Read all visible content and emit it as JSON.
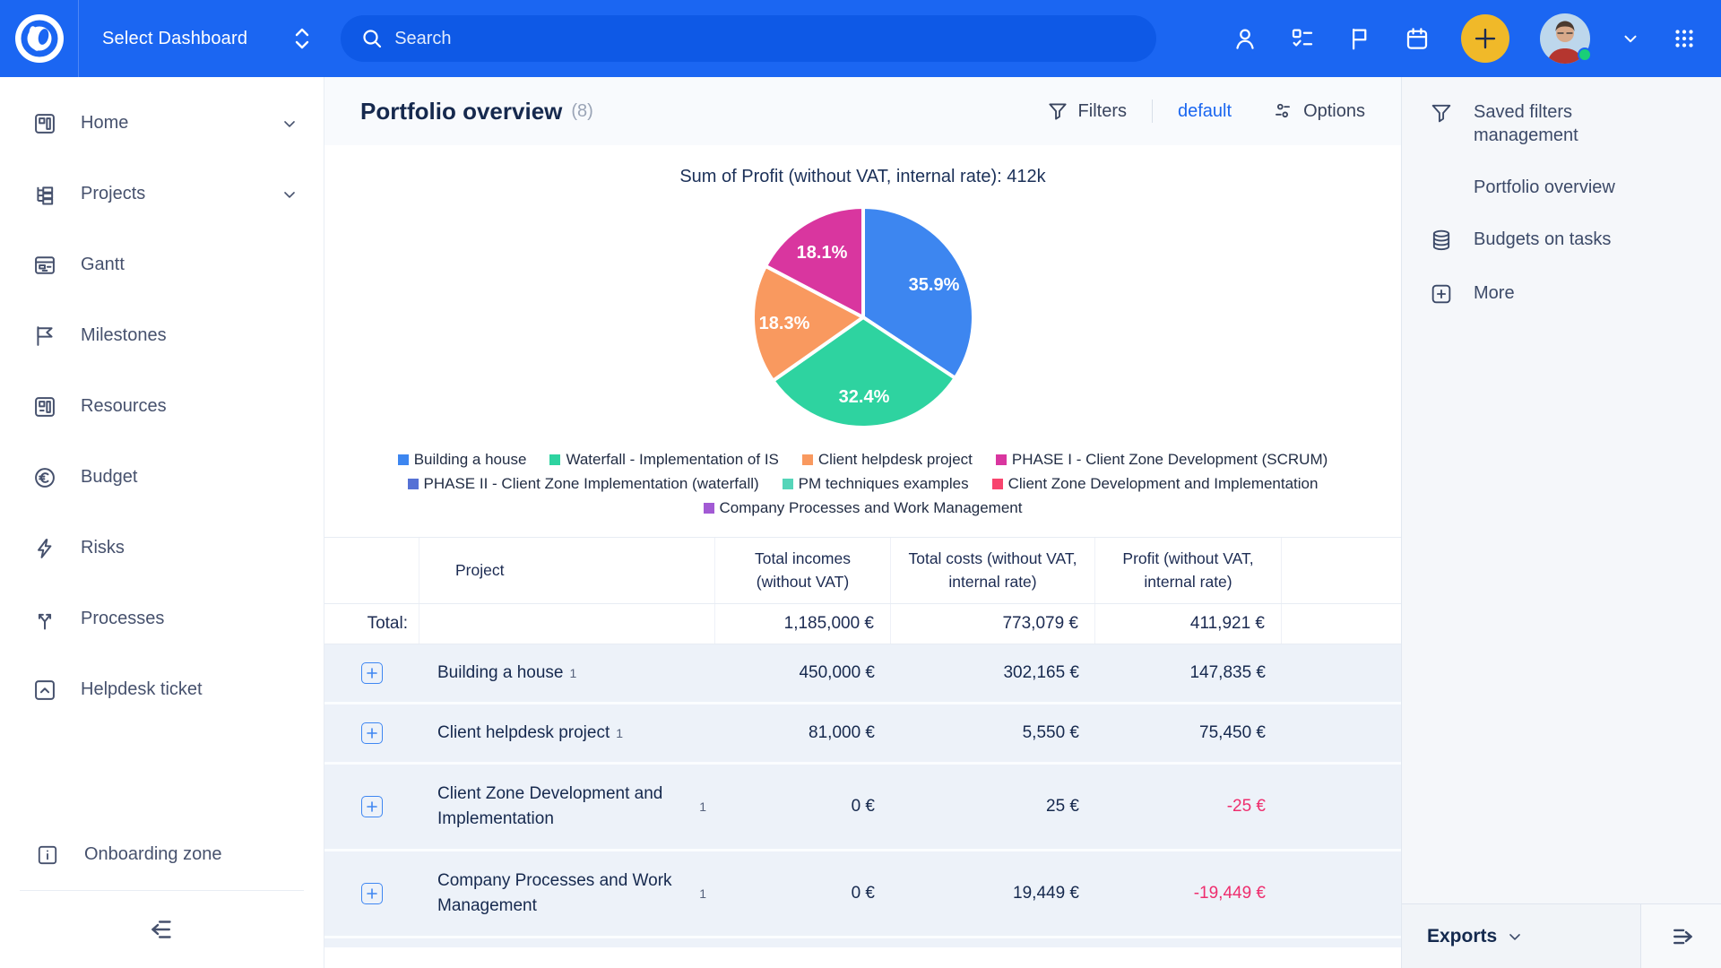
{
  "topbar": {
    "dashboard_selector": "Select Dashboard",
    "search_placeholder": "Search",
    "icons": [
      "user",
      "tasks-checklist",
      "flag",
      "calendar",
      "add",
      "avatar",
      "caret-down",
      "apps-grid"
    ],
    "colors": {
      "bar": "#1b66f2",
      "add_button": "#f0b929",
      "online_dot": "#19cf78"
    }
  },
  "sidebar": {
    "items": [
      {
        "label": "Home",
        "icon": "dashboard-icon",
        "expandable": true
      },
      {
        "label": "Projects",
        "icon": "projects-tree-icon",
        "expandable": true
      },
      {
        "label": "Gantt",
        "icon": "gantt-icon",
        "expandable": false
      },
      {
        "label": "Milestones",
        "icon": "flag-icon",
        "expandable": false
      },
      {
        "label": "Resources",
        "icon": "resources-icon",
        "expandable": false
      },
      {
        "label": "Budget",
        "icon": "euro-circle-icon",
        "expandable": false
      },
      {
        "label": "Risks",
        "icon": "lightning-icon",
        "expandable": false
      },
      {
        "label": "Processes",
        "icon": "fork-icon",
        "expandable": false
      },
      {
        "label": "Helpdesk ticket",
        "icon": "helpdesk-icon",
        "expandable": false
      }
    ],
    "footer_item": {
      "label": "Onboarding zone",
      "icon": "info-icon"
    }
  },
  "main": {
    "title": "Portfolio overview",
    "count": "(8)",
    "filters_label": "Filters",
    "filters_value": "default",
    "options_label": "Options"
  },
  "chart_data": {
    "type": "pie",
    "title": "Sum of Profit (without VAT, internal rate): 412k",
    "legend_position": "bottom",
    "slices": [
      {
        "label": "Building a house",
        "value_pct": 35.9,
        "display": "35.9%",
        "color": "#3d86f0"
      },
      {
        "label": "Waterfall - Implementation of IS",
        "value_pct": 32.4,
        "display": "32.4%",
        "color": "#2ed3a0"
      },
      {
        "label": "Client helpdesk project",
        "value_pct": 18.3,
        "display": "18.3%",
        "color": "#f9995f"
      },
      {
        "label": "PHASE I - Client Zone Development (SCRUM)",
        "value_pct": 18.1,
        "display": "18.1%",
        "color": "#d9369f"
      }
    ],
    "legend": [
      {
        "label": "Building a house",
        "color": "#3d86f0"
      },
      {
        "label": "Waterfall - Implementation of IS",
        "color": "#2ed3a0"
      },
      {
        "label": "Client helpdesk project",
        "color": "#f9995f"
      },
      {
        "label": "PHASE I - Client Zone Development (SCRUM)",
        "color": "#d9369f"
      },
      {
        "label": "PHASE II - Client Zone Implementation (waterfall)",
        "color": "#5571d5"
      },
      {
        "label": "PM techniques examples",
        "color": "#55d5b9"
      },
      {
        "label": "Client Zone Development and Implementation",
        "color": "#f8446e"
      },
      {
        "label": "Company Processes and Work Management",
        "color": "#a25ad4"
      }
    ]
  },
  "table": {
    "columns": {
      "project": "Project",
      "incomes": "Total incomes (without VAT)",
      "costs": "Total costs (without VAT, internal rate)",
      "profit": "Profit (without VAT, internal rate)"
    },
    "total": {
      "label": "Total:",
      "incomes": "1,185,000 €",
      "costs": "773,079 €",
      "profit": "411,921 €"
    },
    "rows": [
      {
        "name": "Building a house",
        "count": "1",
        "incomes": "450,000 €",
        "costs": "302,165 €",
        "profit": "147,835 €"
      },
      {
        "name": "Client helpdesk project",
        "count": "1",
        "incomes": "81,000 €",
        "costs": "5,550 €",
        "profit": "75,450 €"
      },
      {
        "name": "Client Zone Development and Implementation",
        "count": "1",
        "incomes": "0 €",
        "costs": "25 €",
        "profit": "-25 €"
      },
      {
        "name": "Company Processes and Work Management",
        "count": "1",
        "incomes": "0 €",
        "costs": "19,449 €",
        "profit": "-19,449 €"
      }
    ],
    "negative_color": "#ee2e6e"
  },
  "right_panel": {
    "items": [
      {
        "label": "Saved filters management",
        "icon": "funnel-icon"
      },
      {
        "label": "Portfolio overview",
        "icon": "none"
      },
      {
        "label": "Budgets on tasks",
        "icon": "database-icon"
      },
      {
        "label": "More",
        "icon": "plus-square-icon"
      }
    ],
    "exports_label": "Exports"
  }
}
